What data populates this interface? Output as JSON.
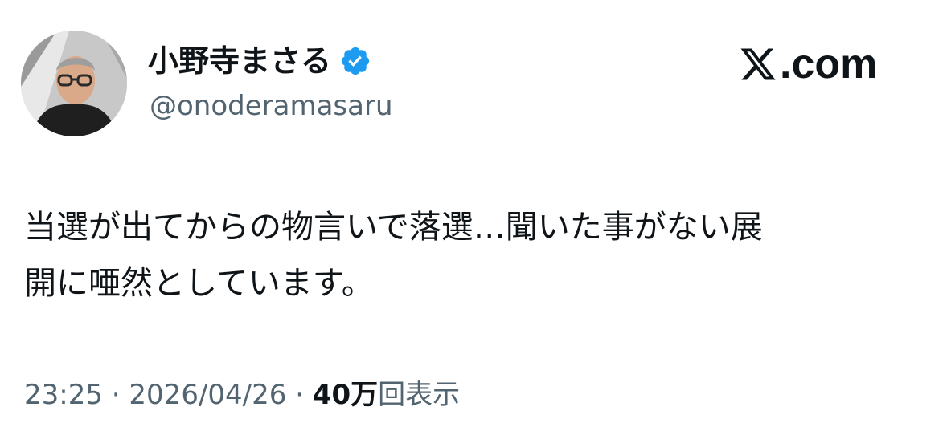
{
  "author": {
    "display_name": "小野寺まさる",
    "handle": "@onoderamasaru",
    "verified": true
  },
  "brand": {
    "logo_suffix": ".com"
  },
  "tweet": {
    "text_line1": "当選が出てからの物言いで落選…聞いた事がない展",
    "text_line2": "開に唖然としています。"
  },
  "meta": {
    "time": "23:25",
    "separator": "·",
    "date": "2026/04/26",
    "views_count": "40万",
    "views_label": "回表示"
  },
  "colors": {
    "text_primary": "#0f1419",
    "text_secondary": "#536471",
    "verified_blue": "#1d9bf0"
  },
  "icons": {
    "verified": "verified-badge-icon",
    "brand": "x-logo-icon"
  }
}
